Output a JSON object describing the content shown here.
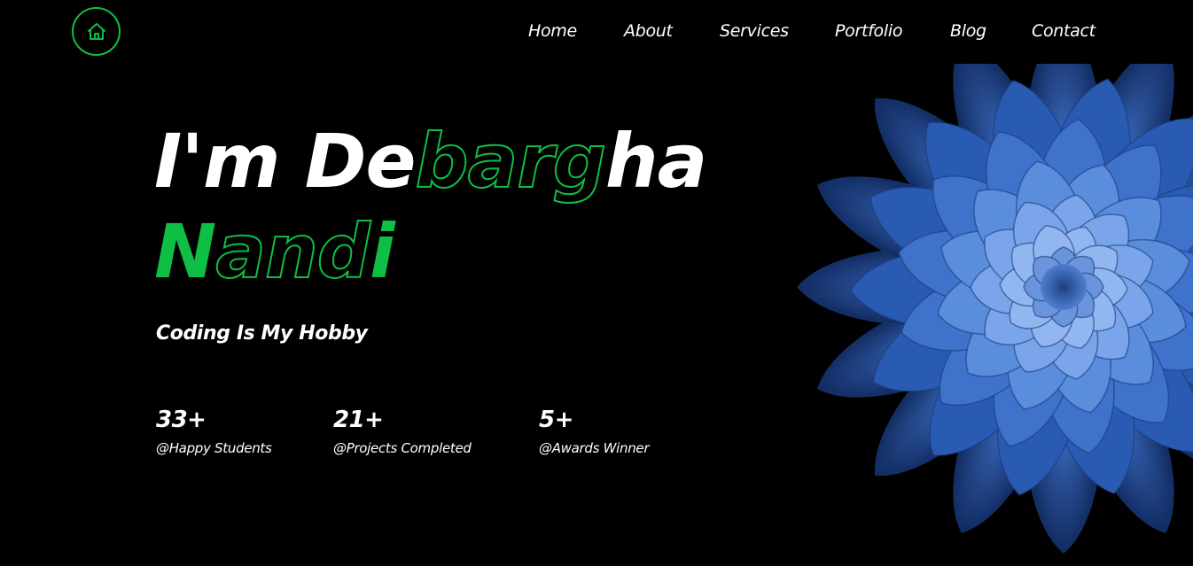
{
  "header": {
    "logo_icon": "home-icon",
    "nav": [
      {
        "label": "Home"
      },
      {
        "label": "About"
      },
      {
        "label": "Services"
      },
      {
        "label": "Portfolio"
      },
      {
        "label": "Blog"
      },
      {
        "label": "Contact"
      }
    ]
  },
  "hero": {
    "name_line1": {
      "prefix": "I'm De",
      "outlined": "barg",
      "suffix": "ha"
    },
    "name_line2": {
      "solid": "N",
      "outlined": "and",
      "suffix": "i"
    },
    "tagline": "Coding Is My Hobby",
    "hero_image": "blue-dahlia-flower"
  },
  "stats": [
    {
      "value": "33+",
      "label": "@Happy Students"
    },
    {
      "value": "21+",
      "label": "@Projects Completed"
    },
    {
      "value": "5+",
      "label": "@Awards Winner"
    }
  ],
  "colors": {
    "background": "#000000",
    "accent": "#0fbe45",
    "text": "#ffffff",
    "flower": "#4a7fd6"
  }
}
